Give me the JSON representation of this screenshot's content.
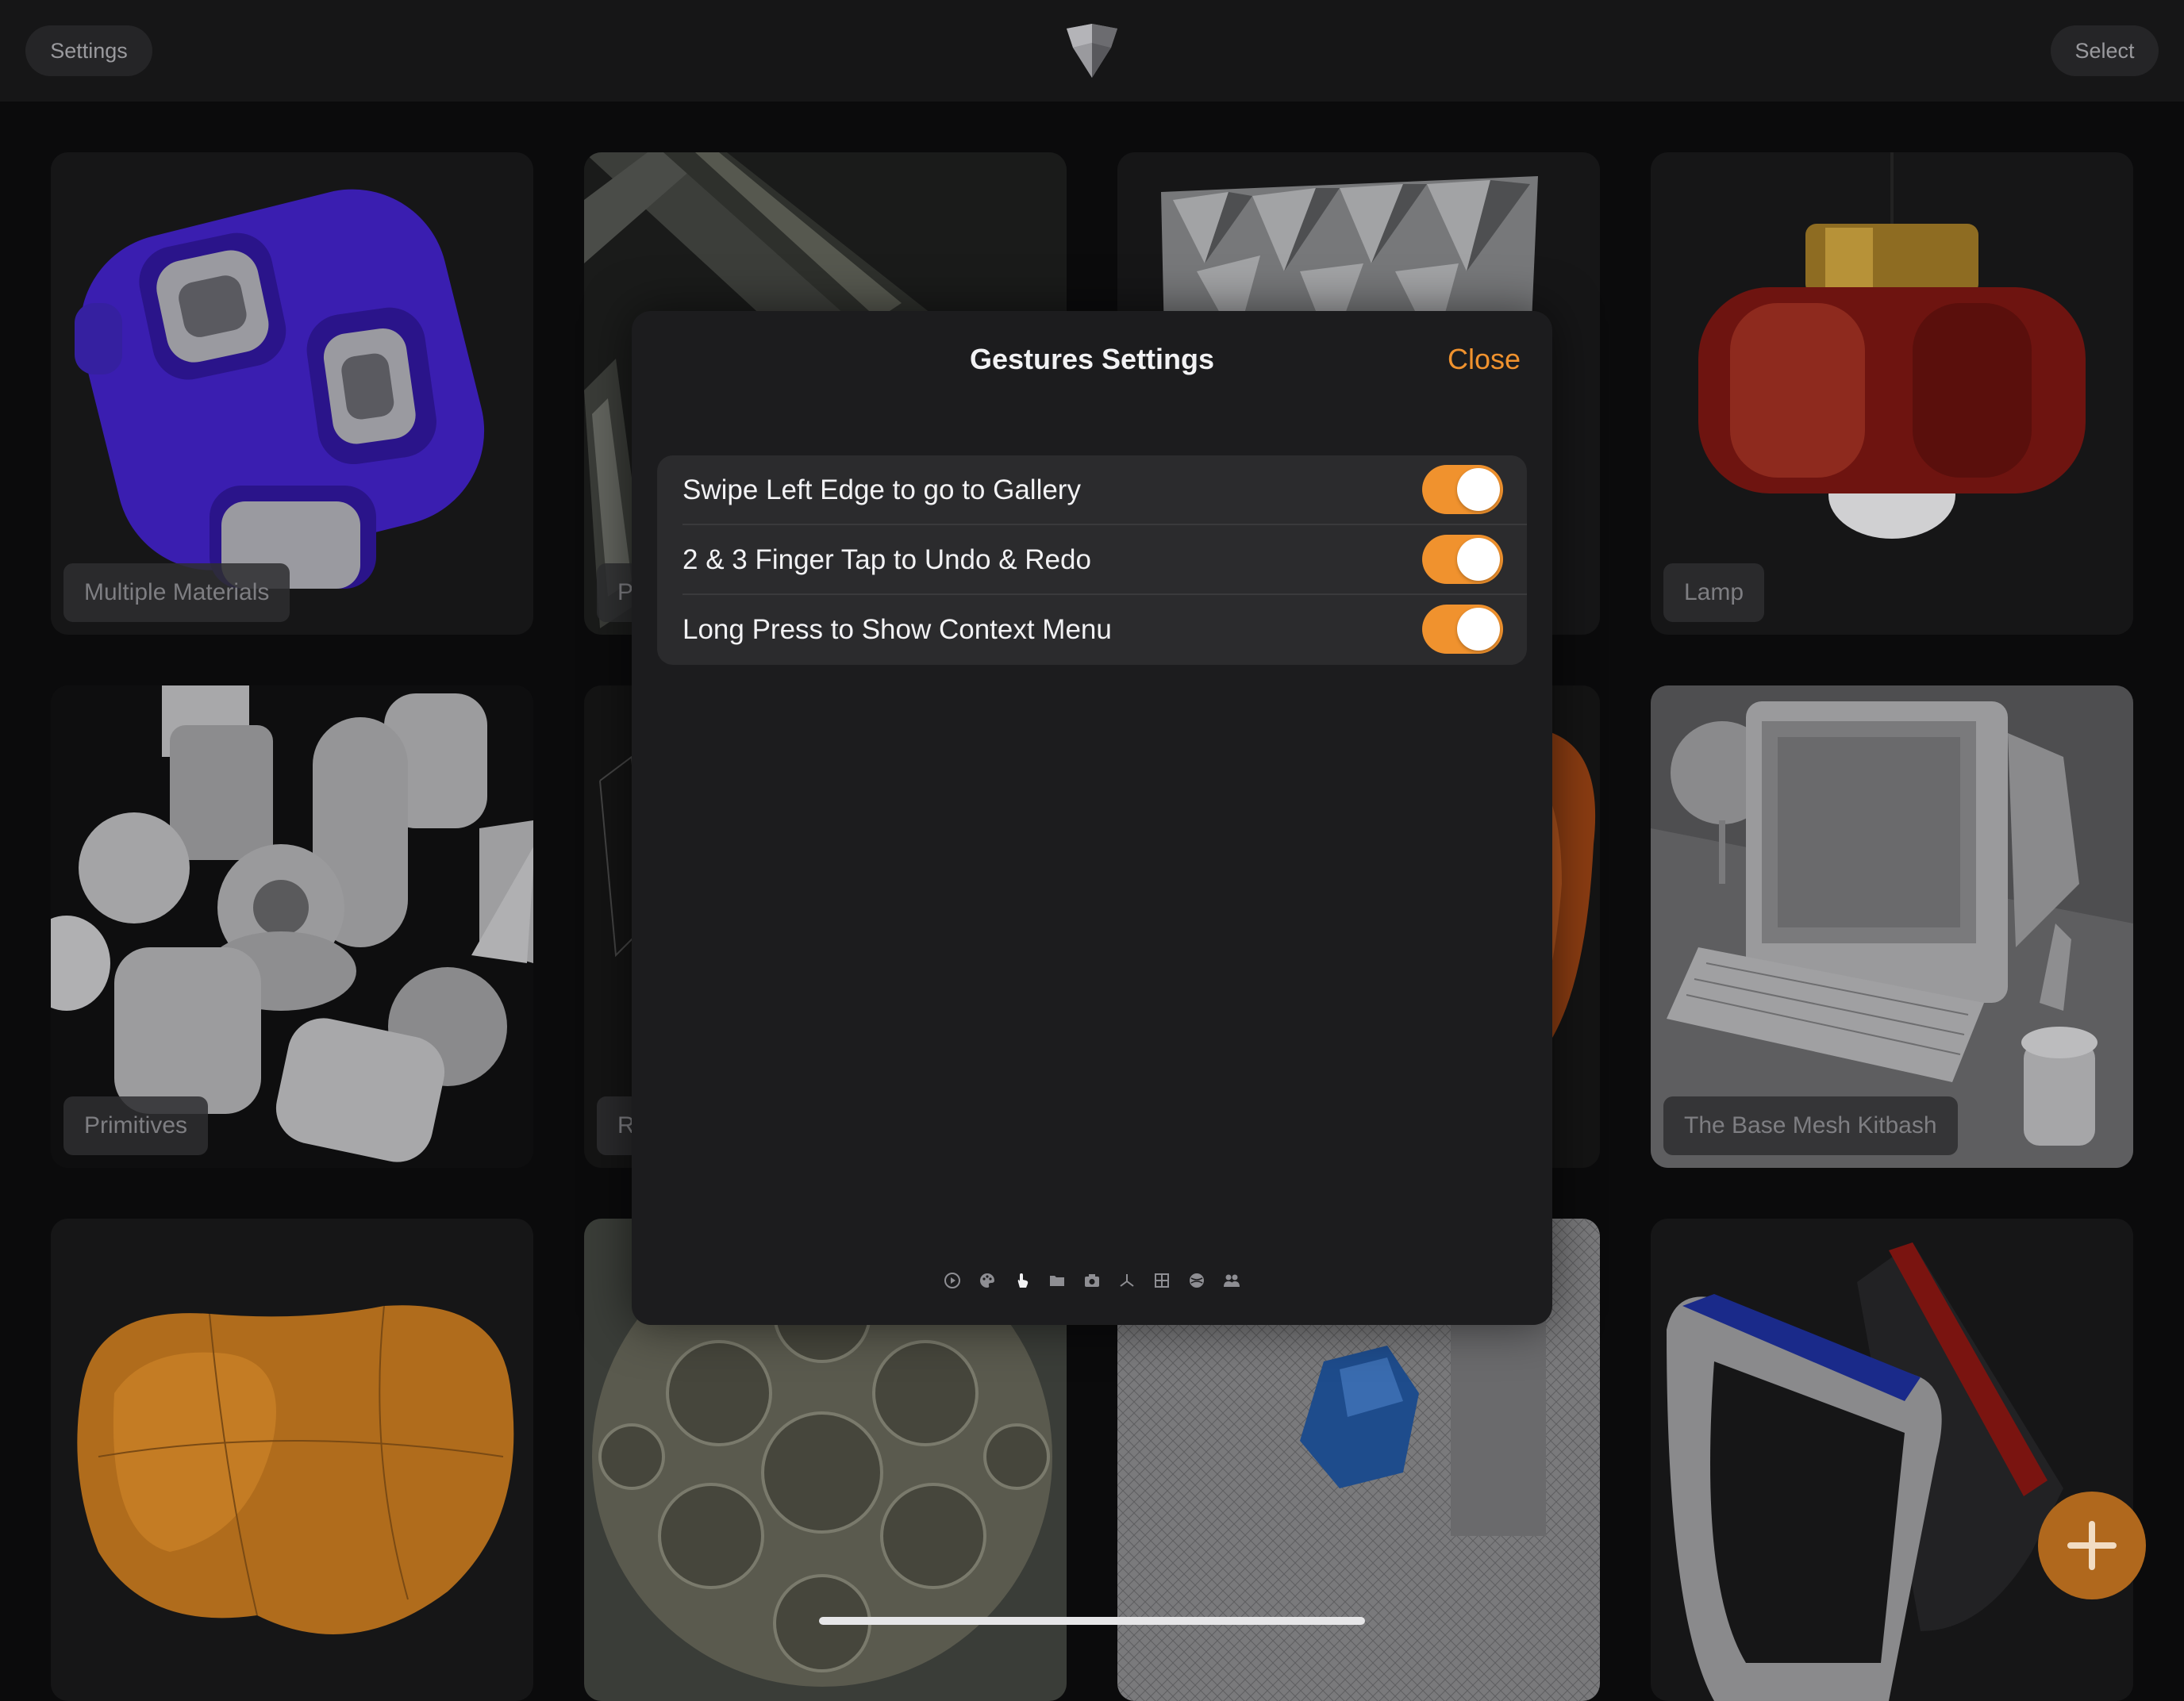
{
  "topbar": {
    "settings_label": "Settings",
    "select_label": "Select",
    "logo_icon": "app-logo-icon"
  },
  "gallery": {
    "items": [
      {
        "label": "Multiple Materials"
      },
      {
        "label": "P"
      },
      {
        "label": ""
      },
      {
        "label": "Lamp"
      },
      {
        "label": "Primitives"
      },
      {
        "label": "R"
      },
      {
        "label": ""
      },
      {
        "label": "The Base Mesh Kitbash"
      },
      {
        "label": ""
      },
      {
        "label": ""
      },
      {
        "label": ""
      },
      {
        "label": ""
      }
    ]
  },
  "modal": {
    "title": "Gestures Settings",
    "close_label": "Close",
    "settings": [
      {
        "label": "Swipe Left Edge to go to Gallery",
        "enabled": true
      },
      {
        "label": "2 & 3 Finger Tap to Undo & Redo",
        "enabled": true
      },
      {
        "label": "Long Press to Show Context Menu",
        "enabled": true
      }
    ],
    "tab_icons": [
      "play-circle-icon",
      "palette-icon",
      "hand-gesture-icon",
      "folder-icon",
      "camera-icon",
      "axes-icon",
      "grid-icon",
      "globe-icon",
      "people-icon"
    ],
    "active_tab": 2
  },
  "colors": {
    "accent": "#f0922e",
    "fab": "#b0681d",
    "modal_bg": "#1c1c1e",
    "group_bg": "#2b2b2d"
  }
}
